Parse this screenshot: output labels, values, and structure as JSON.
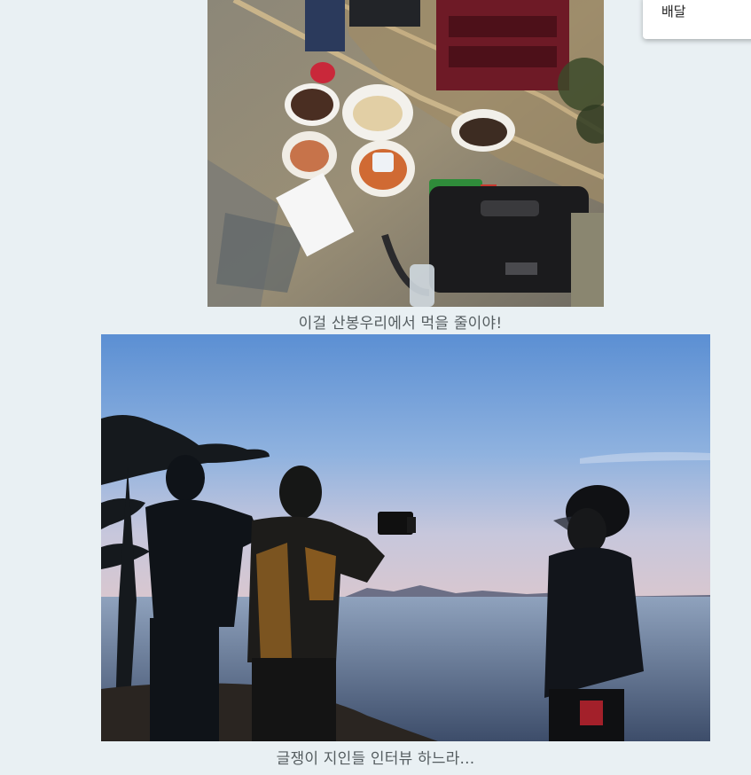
{
  "menu": {
    "items": [
      {
        "label": "배달"
      }
    ]
  },
  "article": {
    "figures": [
      {
        "caption": "이걸 산봉우리에서 먹을 줄이야!"
      },
      {
        "caption": "글쟁이 지인들 인터뷰 하느라..."
      }
    ]
  },
  "colors": {
    "page_background": "#e9f0f3",
    "caption_text": "#555d60",
    "menu_background": "#ffffff"
  }
}
